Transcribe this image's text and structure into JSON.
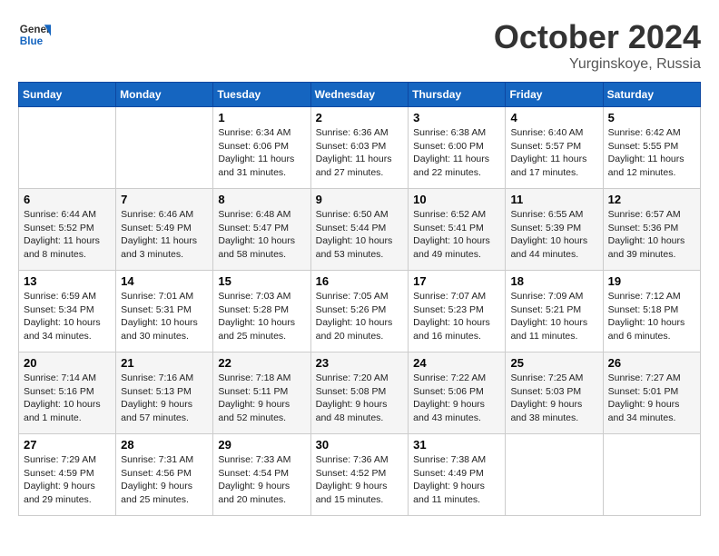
{
  "header": {
    "logo_general": "General",
    "logo_blue": "Blue",
    "month": "October 2024",
    "location": "Yurginskoye, Russia"
  },
  "days_of_week": [
    "Sunday",
    "Monday",
    "Tuesday",
    "Wednesday",
    "Thursday",
    "Friday",
    "Saturday"
  ],
  "weeks": [
    [
      null,
      null,
      {
        "day": "1",
        "sunrise": "Sunrise: 6:34 AM",
        "sunset": "Sunset: 6:06 PM",
        "daylight": "Daylight: 11 hours and 31 minutes."
      },
      {
        "day": "2",
        "sunrise": "Sunrise: 6:36 AM",
        "sunset": "Sunset: 6:03 PM",
        "daylight": "Daylight: 11 hours and 27 minutes."
      },
      {
        "day": "3",
        "sunrise": "Sunrise: 6:38 AM",
        "sunset": "Sunset: 6:00 PM",
        "daylight": "Daylight: 11 hours and 22 minutes."
      },
      {
        "day": "4",
        "sunrise": "Sunrise: 6:40 AM",
        "sunset": "Sunset: 5:57 PM",
        "daylight": "Daylight: 11 hours and 17 minutes."
      },
      {
        "day": "5",
        "sunrise": "Sunrise: 6:42 AM",
        "sunset": "Sunset: 5:55 PM",
        "daylight": "Daylight: 11 hours and 12 minutes."
      }
    ],
    [
      {
        "day": "6",
        "sunrise": "Sunrise: 6:44 AM",
        "sunset": "Sunset: 5:52 PM",
        "daylight": "Daylight: 11 hours and 8 minutes."
      },
      {
        "day": "7",
        "sunrise": "Sunrise: 6:46 AM",
        "sunset": "Sunset: 5:49 PM",
        "daylight": "Daylight: 11 hours and 3 minutes."
      },
      {
        "day": "8",
        "sunrise": "Sunrise: 6:48 AM",
        "sunset": "Sunset: 5:47 PM",
        "daylight": "Daylight: 10 hours and 58 minutes."
      },
      {
        "day": "9",
        "sunrise": "Sunrise: 6:50 AM",
        "sunset": "Sunset: 5:44 PM",
        "daylight": "Daylight: 10 hours and 53 minutes."
      },
      {
        "day": "10",
        "sunrise": "Sunrise: 6:52 AM",
        "sunset": "Sunset: 5:41 PM",
        "daylight": "Daylight: 10 hours and 49 minutes."
      },
      {
        "day": "11",
        "sunrise": "Sunrise: 6:55 AM",
        "sunset": "Sunset: 5:39 PM",
        "daylight": "Daylight: 10 hours and 44 minutes."
      },
      {
        "day": "12",
        "sunrise": "Sunrise: 6:57 AM",
        "sunset": "Sunset: 5:36 PM",
        "daylight": "Daylight: 10 hours and 39 minutes."
      }
    ],
    [
      {
        "day": "13",
        "sunrise": "Sunrise: 6:59 AM",
        "sunset": "Sunset: 5:34 PM",
        "daylight": "Daylight: 10 hours and 34 minutes."
      },
      {
        "day": "14",
        "sunrise": "Sunrise: 7:01 AM",
        "sunset": "Sunset: 5:31 PM",
        "daylight": "Daylight: 10 hours and 30 minutes."
      },
      {
        "day": "15",
        "sunrise": "Sunrise: 7:03 AM",
        "sunset": "Sunset: 5:28 PM",
        "daylight": "Daylight: 10 hours and 25 minutes."
      },
      {
        "day": "16",
        "sunrise": "Sunrise: 7:05 AM",
        "sunset": "Sunset: 5:26 PM",
        "daylight": "Daylight: 10 hours and 20 minutes."
      },
      {
        "day": "17",
        "sunrise": "Sunrise: 7:07 AM",
        "sunset": "Sunset: 5:23 PM",
        "daylight": "Daylight: 10 hours and 16 minutes."
      },
      {
        "day": "18",
        "sunrise": "Sunrise: 7:09 AM",
        "sunset": "Sunset: 5:21 PM",
        "daylight": "Daylight: 10 hours and 11 minutes."
      },
      {
        "day": "19",
        "sunrise": "Sunrise: 7:12 AM",
        "sunset": "Sunset: 5:18 PM",
        "daylight": "Daylight: 10 hours and 6 minutes."
      }
    ],
    [
      {
        "day": "20",
        "sunrise": "Sunrise: 7:14 AM",
        "sunset": "Sunset: 5:16 PM",
        "daylight": "Daylight: 10 hours and 1 minute."
      },
      {
        "day": "21",
        "sunrise": "Sunrise: 7:16 AM",
        "sunset": "Sunset: 5:13 PM",
        "daylight": "Daylight: 9 hours and 57 minutes."
      },
      {
        "day": "22",
        "sunrise": "Sunrise: 7:18 AM",
        "sunset": "Sunset: 5:11 PM",
        "daylight": "Daylight: 9 hours and 52 minutes."
      },
      {
        "day": "23",
        "sunrise": "Sunrise: 7:20 AM",
        "sunset": "Sunset: 5:08 PM",
        "daylight": "Daylight: 9 hours and 48 minutes."
      },
      {
        "day": "24",
        "sunrise": "Sunrise: 7:22 AM",
        "sunset": "Sunset: 5:06 PM",
        "daylight": "Daylight: 9 hours and 43 minutes."
      },
      {
        "day": "25",
        "sunrise": "Sunrise: 7:25 AM",
        "sunset": "Sunset: 5:03 PM",
        "daylight": "Daylight: 9 hours and 38 minutes."
      },
      {
        "day": "26",
        "sunrise": "Sunrise: 7:27 AM",
        "sunset": "Sunset: 5:01 PM",
        "daylight": "Daylight: 9 hours and 34 minutes."
      }
    ],
    [
      {
        "day": "27",
        "sunrise": "Sunrise: 7:29 AM",
        "sunset": "Sunset: 4:59 PM",
        "daylight": "Daylight: 9 hours and 29 minutes."
      },
      {
        "day": "28",
        "sunrise": "Sunrise: 7:31 AM",
        "sunset": "Sunset: 4:56 PM",
        "daylight": "Daylight: 9 hours and 25 minutes."
      },
      {
        "day": "29",
        "sunrise": "Sunrise: 7:33 AM",
        "sunset": "Sunset: 4:54 PM",
        "daylight": "Daylight: 9 hours and 20 minutes."
      },
      {
        "day": "30",
        "sunrise": "Sunrise: 7:36 AM",
        "sunset": "Sunset: 4:52 PM",
        "daylight": "Daylight: 9 hours and 15 minutes."
      },
      {
        "day": "31",
        "sunrise": "Sunrise: 7:38 AM",
        "sunset": "Sunset: 4:49 PM",
        "daylight": "Daylight: 9 hours and 11 minutes."
      },
      null,
      null
    ]
  ]
}
